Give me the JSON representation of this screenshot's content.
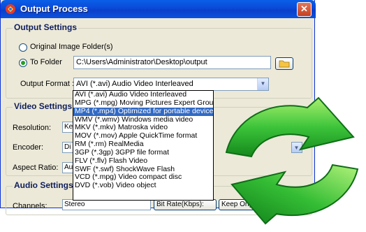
{
  "window": {
    "title": "Output Process",
    "close_label": "✕"
  },
  "output_settings": {
    "heading": "Output Settings",
    "original_folder_label": "Original Image Folder(s)",
    "to_folder_label": "To Folder",
    "folder_path": "C:\\Users\\Administrator\\Desktop\\output",
    "format_label": "Output Format :",
    "format_value": "AVI  (*.avi) Audio Video Interleaved",
    "format_options": [
      "AVI  (*.avi) Audio Video Interleaved",
      "MPG  (*.mpg) Moving Pictures Expert Group",
      "MP4  (*.mp4) Optimized for portable device",
      "WMV  (*.wmv) Windows media video",
      "MKV  (*.mkv) Matroska video",
      "MOV  (*.mov) Apple QuickTime format",
      "RM  (*.rm) RealMedia",
      "3GP  (*.3gp) 3GPP file format",
      "FLV  (*.flv) Flash Video",
      "SWF  (*.swf) ShockWave Flash",
      "VCD  (*.mpg) Video compact disc",
      "DVD  (*.vob) Video object"
    ],
    "selected_index": 2
  },
  "video_settings": {
    "heading": "Video Settings",
    "resolution_label": "Resolution:",
    "resolution_value": "Ke",
    "encoder_label": "Encoder:",
    "encoder_value": "Di",
    "aspect_label": "Aspect Ratio:",
    "aspect_value": "Au"
  },
  "audio_settings": {
    "heading": "Audio Settings",
    "channels_label": "Channels:",
    "channels_value": "Stereo",
    "bitrate_label": "Bit Rate(Kbps):",
    "keep_original_label": "Keep Original"
  },
  "colors": {
    "titlebar": "#0a4ad8",
    "highlight": "#316ac5",
    "arrow_green": "#2fb82f"
  }
}
